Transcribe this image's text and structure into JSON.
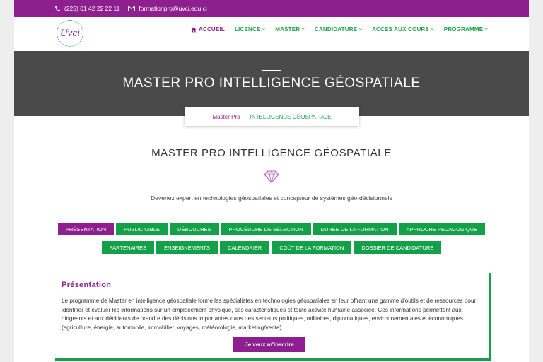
{
  "topbar": {
    "phone_icon": "phone-icon",
    "phone": "(225) 01 42 22 22 11",
    "email_icon": "envelope-icon",
    "email": "formationpro@uvci.edu.ci",
    "bg_color": "#8e1f8e"
  },
  "header": {
    "logo_text": "Uvci",
    "nav": [
      {
        "label": "ACCUEIL",
        "icon": "home-icon",
        "active": true
      },
      {
        "label": "LICENCE",
        "dropdown": true
      },
      {
        "label": "MASTER",
        "dropdown": true
      },
      {
        "label": "CANDIDATURE",
        "dropdown": true
      },
      {
        "label": "ACCES AUX COURS",
        "dropdown": true
      },
      {
        "label": "PROGRAMME",
        "dropdown": true
      }
    ]
  },
  "banner": {
    "title": "MASTER PRO INTELLIGENCE GÉOSPATIALE",
    "breadcrumb": [
      "Master Pro",
      "INTELLIGENCE GÉOSPATIALE"
    ]
  },
  "section": {
    "title": "MASTER PRO INTELLIGENCE GÉOSPATIALE",
    "divider_icon": "diamond-icon",
    "subtitle": "Devenez expert en technologies géospatiales et concepteur de systèmes géo-décisionnels"
  },
  "tabs_row1": [
    "PRÉSENTATION",
    "PUBLIC CIBLE",
    "DÉBOUCHÉS",
    "PROCÉDURE DE SÉLECTION",
    "DURÉE DE LA FORMATION",
    "APPROCHE PÉDAGOGIQUE"
  ],
  "tabs_row2": [
    "PARTENAIRES",
    "ENSEIGNEMENTS",
    "CALENDRIER",
    "COÛT DE LA FORMATION",
    "DOSSIER DE CANDIDATURE"
  ],
  "active_tab": "PRÉSENTATION",
  "content": {
    "title": "Présentation",
    "body": "Le programme de Master en intelligence géospatiale forme les spécialistes en technologies géospatiales en leur offrant une gamme d'outils et de ressources pour identifier et évaluer les informations sur un emplacement physique, ses caractéristiques et toute activité humaine associée. Ces informations permettent aux dirigeants et aux décideurs de prendre des décisions importantes dans des secteurs politiques, militaires, diplomatiques, environnementales et économiques (agriculture, énergie, automobile, immobilier, voyages, météorologie, marketing/vente).",
    "button": "Je veux m'inscrire"
  },
  "colors": {
    "purple": "#8e1f8e",
    "green": "#13a049",
    "banner": "#4a4a4a"
  }
}
